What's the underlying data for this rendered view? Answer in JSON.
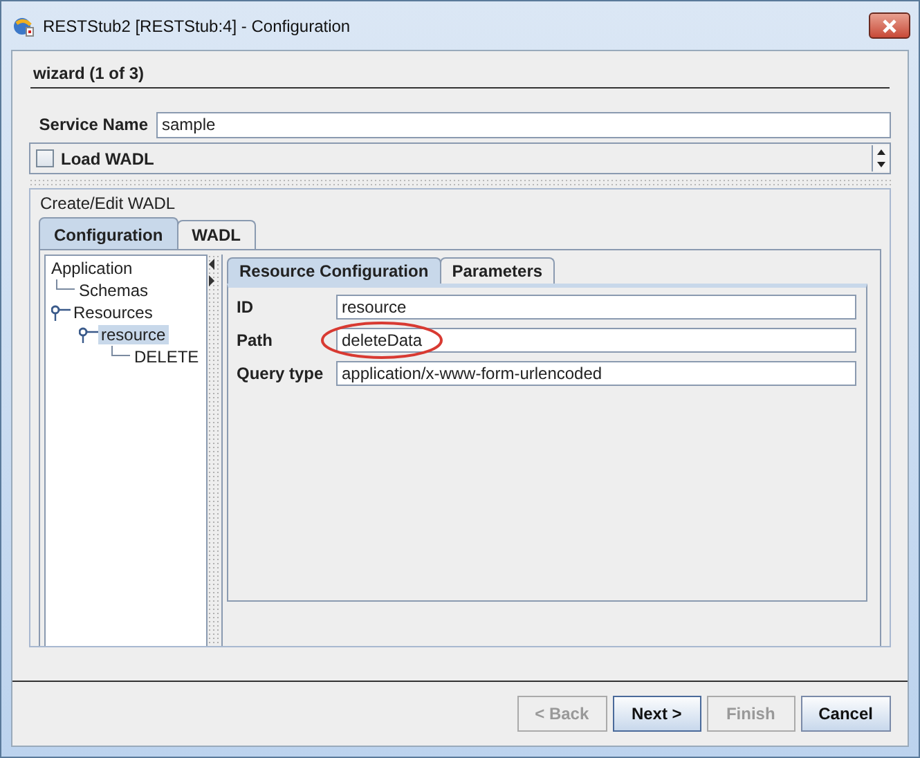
{
  "window": {
    "title": "RESTStub2 [RESTStub:4] - Configuration"
  },
  "wizard": {
    "title": "wizard (1 of 3)"
  },
  "service_name": {
    "label": "Service Name",
    "value": "sample"
  },
  "load_wadl": {
    "label": "Load WADL",
    "checked": false
  },
  "group": {
    "title": "Create/Edit WADL"
  },
  "tabs": [
    {
      "label": "Configuration",
      "selected": true
    },
    {
      "label": "WADL",
      "selected": false
    }
  ],
  "tree": [
    {
      "label": "Application",
      "selected": false,
      "children": [
        {
          "label": "Schemas",
          "selected": false
        },
        {
          "label": "Resources",
          "selected": false,
          "expanded": true,
          "children": [
            {
              "label": "resource",
              "selected": true,
              "expanded": true,
              "children": [
                {
                  "label": "DELETE",
                  "selected": false
                }
              ]
            }
          ]
        }
      ]
    }
  ],
  "inner_tabs": [
    {
      "label": "Resource Configuration",
      "selected": true
    },
    {
      "label": "Parameters",
      "selected": false
    }
  ],
  "fields": [
    {
      "label": "ID",
      "value": "resource",
      "circled": false
    },
    {
      "label": "Path",
      "value": "deleteData",
      "circled": true
    },
    {
      "label": "Query type",
      "value": "application/x-www-form-urlencoded",
      "circled": false
    }
  ],
  "buttons": [
    {
      "label": "< Back",
      "disabled": true,
      "default": false
    },
    {
      "label": "Next >",
      "disabled": false,
      "default": true
    },
    {
      "label": "Finish",
      "disabled": true,
      "default": false
    },
    {
      "label": "Cancel",
      "disabled": false,
      "default": false
    }
  ]
}
